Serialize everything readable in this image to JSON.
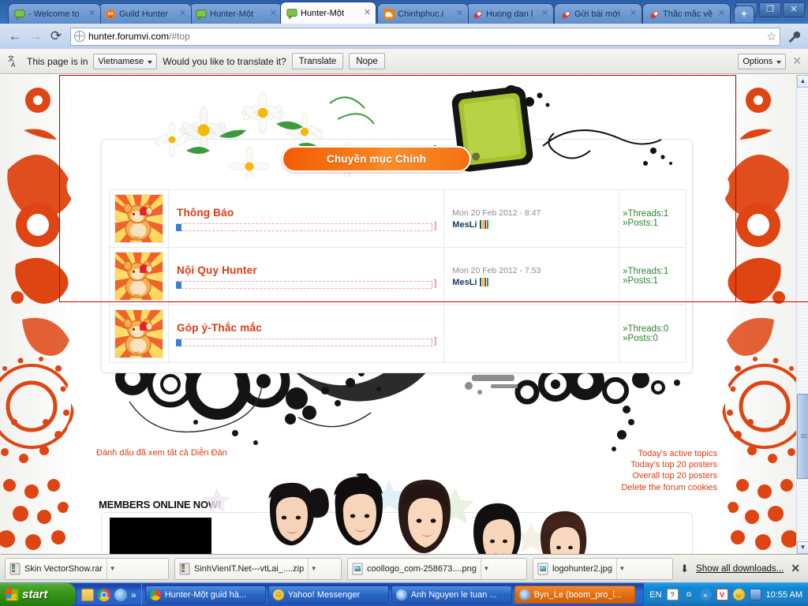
{
  "browser": {
    "tabs": [
      {
        "label": "- Welcome to",
        "icon": "chat-bubble-icon",
        "active": false
      },
      {
        "label": "Guild Hunter",
        "icon": "orange-mascot-icon",
        "active": false
      },
      {
        "label": "Hunter-Một",
        "icon": "chat-bubble-icon",
        "active": false
      },
      {
        "label": "Hunter-Một",
        "icon": "chat-bubble-icon",
        "active": true
      },
      {
        "label": "Chinhphuc.i",
        "icon": "blogger-icon",
        "active": false
      },
      {
        "label": "Huong dan l",
        "icon": "capsule-icon",
        "active": false
      },
      {
        "label": "Gửi bài mới",
        "icon": "capsule-icon",
        "active": false
      },
      {
        "label": "Thắc mắc về",
        "icon": "capsule-icon",
        "active": false
      }
    ],
    "new_tab_label": "+",
    "window_controls": {
      "minimize": "–",
      "restore": "❐",
      "close": "✕"
    },
    "nav": {
      "back": "←",
      "forward": "→",
      "reload": "⟳"
    },
    "url_host": "hunter.forumvi.com",
    "url_path": "/#top",
    "star_icon": "☆",
    "wrench_icon": "🔧"
  },
  "infobar": {
    "icon_name": "translate-icon",
    "prefix_text": "This page is in",
    "language": "Vietnamese",
    "question_text": "Would you like to translate it?",
    "translate_label": "Translate",
    "nope_label": "Nope",
    "options_label": "Options",
    "close_label": "✕"
  },
  "page": {
    "category_title": "Chuyền mục Chính",
    "forums": [
      {
        "title": "Thông Báo",
        "last_post_date": "Mon 20 Feb 2012 - 8:47",
        "last_post_user": "MesLi",
        "threads_label": "»Threads:1",
        "posts_label": "»Posts:1"
      },
      {
        "title": "Nội Quy Hunter",
        "last_post_date": "Mon 20 Feb 2012 - 7:53",
        "last_post_user": "MesLi",
        "threads_label": "»Threads:1",
        "posts_label": "»Posts:1"
      },
      {
        "title": "Góp ý-Thắc mắc",
        "last_post_date": "",
        "last_post_user": "",
        "threads_label": "»Threads:0",
        "posts_label": "»Posts:0"
      }
    ],
    "mark_read_label": "Đánh dấu đã xem tất cả Diễn Đàn",
    "right_links": [
      "Today's active topics",
      "Today's top 20 posters",
      "Overall top 20 posters",
      "Delete the forum cookies"
    ],
    "members_online_title": "MEMBERS ONLINE NOW!"
  },
  "downloads": {
    "items": [
      {
        "name": "Skin VectorShow.rar",
        "icon": "archive-icon"
      },
      {
        "name": "SinhVienIT.Net---vtLai_....zip",
        "icon": "archive-icon"
      },
      {
        "name": "coollogo_com-258673....png",
        "icon": "image-icon"
      },
      {
        "name": "logohunter2.jpg",
        "icon": "image-icon"
      }
    ],
    "show_all_label": "Show all downloads...",
    "arrow_icon": "⬇",
    "close_label": "✕"
  },
  "taskbar": {
    "start_label": "start",
    "quick_launch": [
      {
        "name": "notepad-icon"
      },
      {
        "name": "chrome-icon"
      },
      {
        "name": "internet-explorer-icon"
      }
    ],
    "quick_more": "»",
    "tasks": [
      {
        "label": "Hunter-Một guid hà...",
        "icon": "chrome-icon",
        "active": false
      },
      {
        "label": "Yahoo! Messenger",
        "icon": "yahoo-icon",
        "active": false
      },
      {
        "label": "Anh Nguyen le tuan ...",
        "icon": "yahoo-chat-icon",
        "active": false
      },
      {
        "label": "Byn_Le (boom_pro_l...",
        "icon": "yahoo-chat-icon",
        "active": true
      }
    ],
    "tray": {
      "language": "EN",
      "help_icon": "?",
      "show_hidden_icon": "«",
      "icons": [
        "avg-icon",
        "yahoo-icon",
        "network-icon"
      ],
      "clock": "10:55 AM"
    }
  },
  "scrollbar": {
    "up_arrow": "▲",
    "down_arrow": "▼"
  },
  "colors": {
    "accent_orange": "#e03a12",
    "banner_orange": "#f47012",
    "selection_red": "#c00000",
    "stat_green": "#2f7f2f",
    "link_blue": "#17365d"
  }
}
